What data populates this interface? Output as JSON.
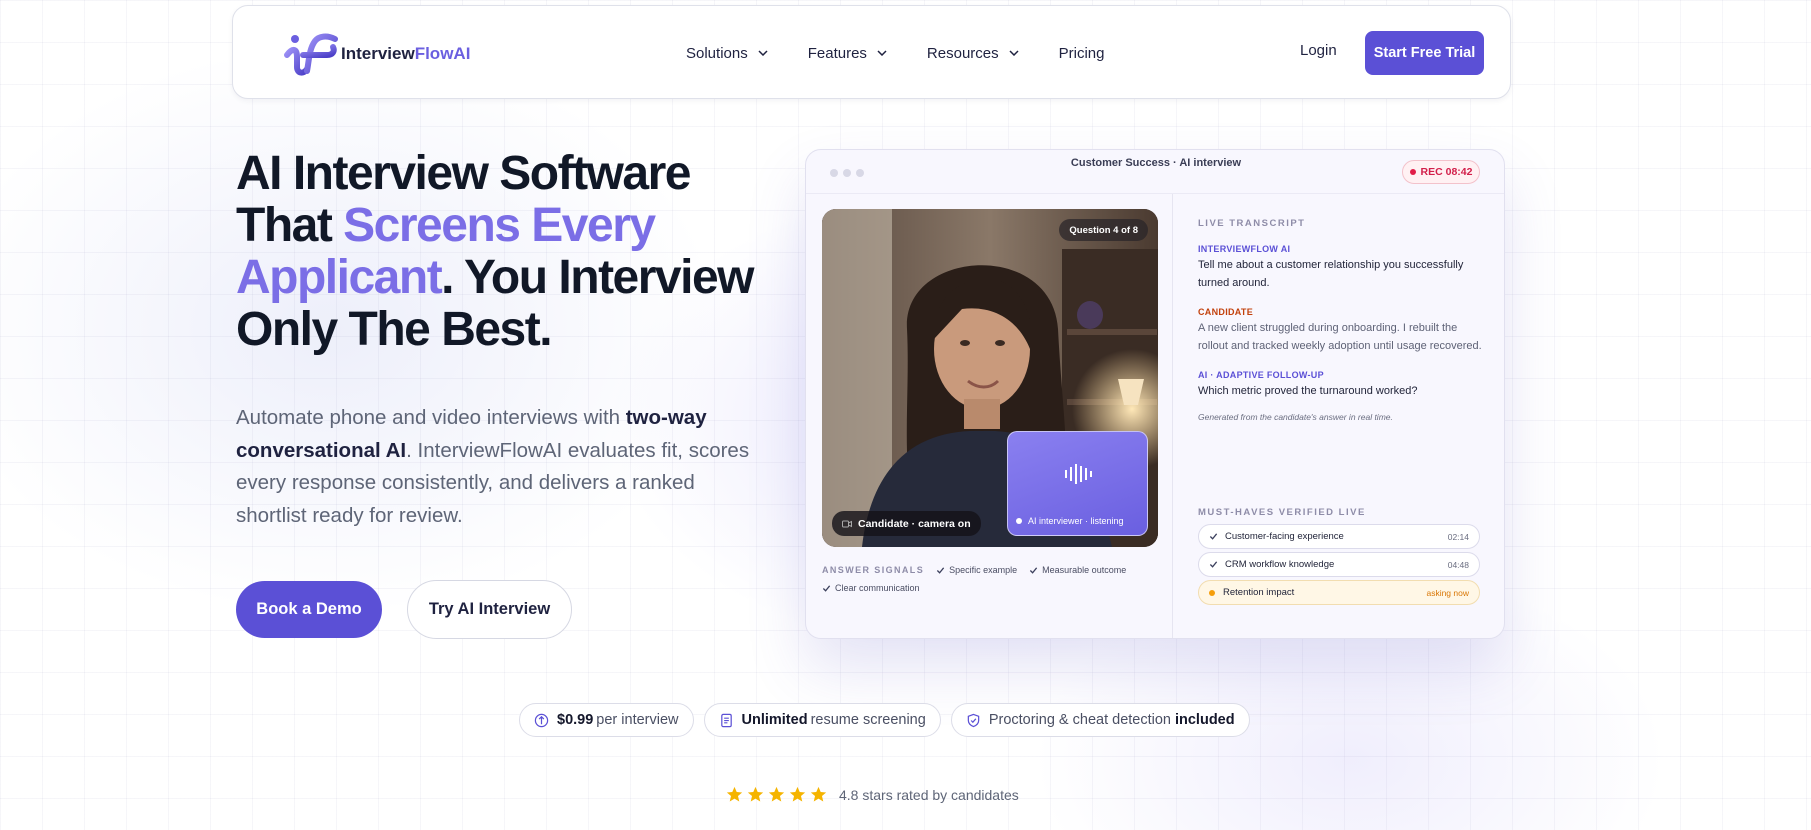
{
  "brand": {
    "name_primary": "Interview",
    "name_accent": "FlowAI",
    "primary_color": "#5b50d6",
    "accent_color": "#7b6ee6"
  },
  "nav": {
    "items": [
      {
        "label": "Solutions",
        "has_dropdown": true
      },
      {
        "label": "Features",
        "has_dropdown": true
      },
      {
        "label": "Resources",
        "has_dropdown": true
      },
      {
        "label": "Pricing",
        "has_dropdown": false
      }
    ],
    "login_label": "Login",
    "cta_label": "Start Free Trial"
  },
  "hero": {
    "title_line1": "AI Interview Software",
    "title_that": "That ",
    "title_highlight1": "Screens Every",
    "title_highlight2": "Applicant",
    "title_rest": ". You Interview",
    "title_line4": "Only The Best.",
    "sub_part1": "Automate phone and video interviews with ",
    "sub_bold": "two-way conversational AI",
    "sub_part2": ". InterviewFlowAI evaluates fit, scores every response consistently, and delivers a ranked shortlist ready for review.",
    "primary_button": "Book a Demo",
    "secondary_button": "Try AI Interview"
  },
  "mockup": {
    "window_title": "Customer Success · AI interview",
    "rec_label": "REC 08:42",
    "question_badge": "Question 4 of 8",
    "camera_status": "Candidate · camera on",
    "ai_status": "AI interviewer · listening",
    "signals": {
      "label": "ANSWER SIGNALS",
      "items": [
        "Specific example",
        "Measurable outcome",
        "Clear communication"
      ]
    },
    "transcript": {
      "label": "LIVE TRANSCRIPT",
      "entries": [
        {
          "speaker": "INTERVIEWFLOW AI",
          "text": "Tell me about a customer relationship you successfully turned around."
        },
        {
          "speaker": "CANDIDATE",
          "text": "A new client struggled during onboarding. I rebuilt the rollout and tracked weekly adoption until usage recovered."
        },
        {
          "speaker": "AI · ADAPTIVE FOLLOW-UP",
          "text": "Which metric proved the turnaround worked?"
        }
      ],
      "note": "Generated from the candidate's answer in real time."
    },
    "musts": {
      "label": "MUST-HAVES VERIFIED LIVE",
      "items": [
        {
          "label": "Customer-facing experience",
          "time": "02:14"
        },
        {
          "label": "CRM workflow knowledge",
          "time": "04:48"
        },
        {
          "label": "Retention impact",
          "status": "asking now"
        }
      ]
    }
  },
  "pills": [
    {
      "bold": "$0.99",
      "text": "per interview",
      "icon": "dollar-circle-icon"
    },
    {
      "bold": "Unlimited",
      "text": "resume screening",
      "icon": "document-icon"
    },
    {
      "text": "Proctoring & cheat detection",
      "bold_after": "included",
      "icon": "shield-check-icon"
    }
  ],
  "rating": {
    "stars": 5,
    "text": "4.8 stars rated by candidates",
    "star_color": "#f5b400"
  }
}
